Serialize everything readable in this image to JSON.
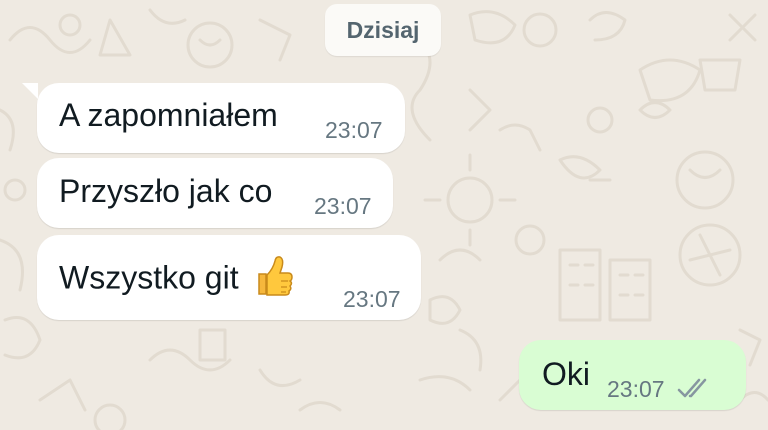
{
  "chat": {
    "date_separator": "Dzisiaj",
    "messages": [
      {
        "direction": "incoming",
        "text": "A zapomniałem",
        "time": "23:07"
      },
      {
        "direction": "incoming",
        "text": "Przyszło jak co",
        "time": "23:07"
      },
      {
        "direction": "incoming",
        "text": "Wszystko git",
        "emoji": "thumbs-up-icon",
        "time": "23:07"
      },
      {
        "direction": "outgoing",
        "text": "Oki",
        "time": "23:07",
        "status": "read-ticks-icon"
      }
    ]
  },
  "colors": {
    "background": "#efeae2",
    "incoming_bubble": "#ffffff",
    "outgoing_bubble": "#d9fdd3",
    "text": "#111b21",
    "timestamp": "#667781",
    "ticks": "#8696a0",
    "date_chip_text": "#54656f"
  }
}
